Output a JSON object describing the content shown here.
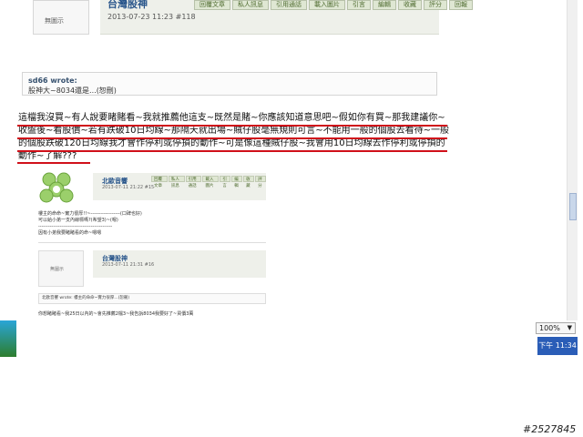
{
  "post": {
    "avatar_text": "無圖示",
    "username": "台灣股神",
    "date_line": "2013-07-23 11:23  #118",
    "toolbar": [
      "回覆文章",
      "私人訊息",
      "引用通話",
      "載入圖片",
      "引言",
      "編輯",
      "收藏",
      "評分",
      "回報"
    ]
  },
  "quote": {
    "author": "sd66 wrote:",
    "text": "股神大~8034還是...(恕刪)"
  },
  "message": {
    "lines": [
      "這檔我沒買~有人說要睹賭看~我就推薦他這支~既然是賭~你應該知道意思吧~假如你有買~那我建議你~",
      "收盤後~看股價~若有跌破10日均線~那隔天就出場~賊仔股毫無規則可言~不能用一般的個股去看待~一般",
      "的個股跌破120日均線我才會作停利或停損的動作~可是像這種賊仔股~我會用10日均線去作停利或停損的",
      "動作~了解???"
    ]
  },
  "embedded": {
    "user1": "北歐音響",
    "user1_sub": "2013-07-11 21:22  #15",
    "tools": [
      "回覆文章",
      "私人訊息",
      "引用通話",
      "載入圖片",
      "引言",
      "編輯",
      "收藏",
      "評分"
    ],
    "lines": [
      "樓主的命命~實力很厚!!~------------------(口碑也好)",
      "可以給小弟一支內線標嗎?(希望3)~(嗯)",
      "---------------------------------------------",
      "因有小弟我要睹睹看的命~嗯嗯"
    ],
    "avatar_text": "無圖示",
    "user2": "台灣股神",
    "user2_sub": "2013-07-11 21:31  #16",
    "quote_text": "北歐音響 wrote: 樓主的命命~實力很厚...(恕刪)",
    "footer": "你想睹睹看~我25日以內的~會先推薦2檔3~我告訴8034我要好了~買價3萬"
  },
  "status": {
    "zoom": "100%",
    "clock": "下午 11:34"
  },
  "watermark": "#2527845",
  "colors": {
    "underline": "#d0101a",
    "header_bg": "#eef0ea",
    "username": "#27548a"
  }
}
